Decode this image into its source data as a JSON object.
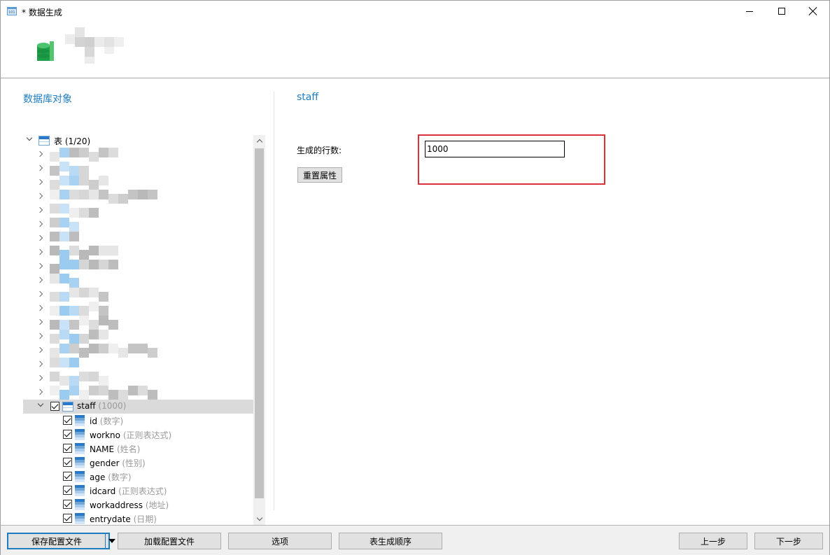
{
  "window": {
    "title": "* 数据生成",
    "minimize_icon": "minimize-icon",
    "maximize_icon": "maximize-icon",
    "close_icon": "close-icon"
  },
  "header": {
    "logo_icon": "database-generate-icon",
    "title_obscured": true
  },
  "left_panel": {
    "heading": "数据库对象",
    "tree": {
      "root": {
        "label": "表",
        "count": "(1/20)",
        "expanded": true
      },
      "collapsed_tables_obscured": 19,
      "selected_table": {
        "name": "staff",
        "rows": "(1000)",
        "checked": true,
        "expanded": true,
        "columns": [
          {
            "name": "id",
            "generator": "(数字)",
            "checked": true
          },
          {
            "name": "workno",
            "generator": "(正则表达式)",
            "checked": true
          },
          {
            "name": "NAME",
            "generator": "(姓名)",
            "checked": true
          },
          {
            "name": "gender",
            "generator": "(性别)",
            "checked": true
          },
          {
            "name": "age",
            "generator": "(数字)",
            "checked": true
          },
          {
            "name": "idcard",
            "generator": "(正则表达式)",
            "checked": true
          },
          {
            "name": "workaddress",
            "generator": "(地址)",
            "checked": true
          },
          {
            "name": "entrydate",
            "generator": "(日期)",
            "checked": true
          }
        ]
      }
    }
  },
  "right_panel": {
    "heading": "staff",
    "rows_label": "生成的行数:",
    "rows_value": "1000",
    "reset_button": "重置属性",
    "highlight_color": "#d9303a"
  },
  "footer": {
    "save_profile": "保存配置文件",
    "load_profile": "加载配置文件",
    "options": "选项",
    "table_order": "表生成顺序",
    "prev": "上一步",
    "next": "下一步"
  },
  "colors": {
    "accent": "#1e7cc1",
    "selection": "#dadada"
  }
}
